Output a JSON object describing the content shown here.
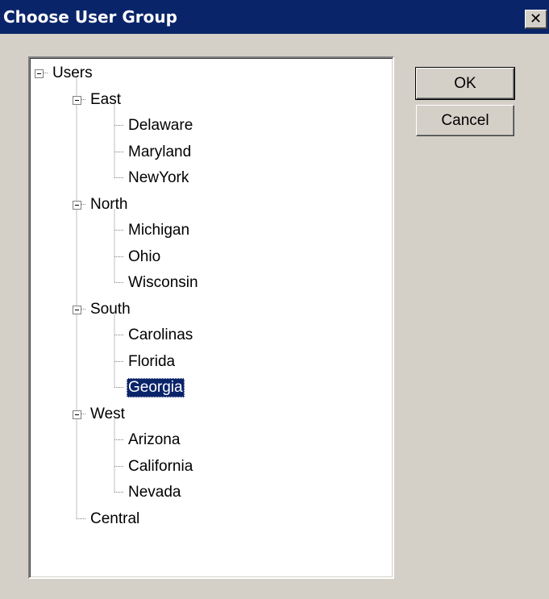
{
  "window": {
    "title": "Choose User Group",
    "close_glyph": "✕"
  },
  "buttons": {
    "ok_label": "OK",
    "cancel_label": "Cancel"
  },
  "tree": {
    "root": "Users",
    "groups": [
      {
        "label": "East",
        "expanded": true,
        "children": [
          "Delaware",
          "Maryland",
          "NewYork"
        ]
      },
      {
        "label": "North",
        "expanded": true,
        "children": [
          "Michigan",
          "Ohio",
          "Wisconsin"
        ]
      },
      {
        "label": "South",
        "expanded": true,
        "children": [
          "Carolinas",
          "Florida",
          "Georgia"
        ]
      },
      {
        "label": "West",
        "expanded": true,
        "children": [
          "Arizona",
          "California",
          "Nevada"
        ]
      },
      {
        "label": "Central",
        "expanded": false,
        "children": []
      }
    ],
    "selected": "Georgia"
  },
  "colors": {
    "face": "#d4d0c8",
    "title_bg": "#0a246a",
    "selection_bg": "#0a246a"
  }
}
